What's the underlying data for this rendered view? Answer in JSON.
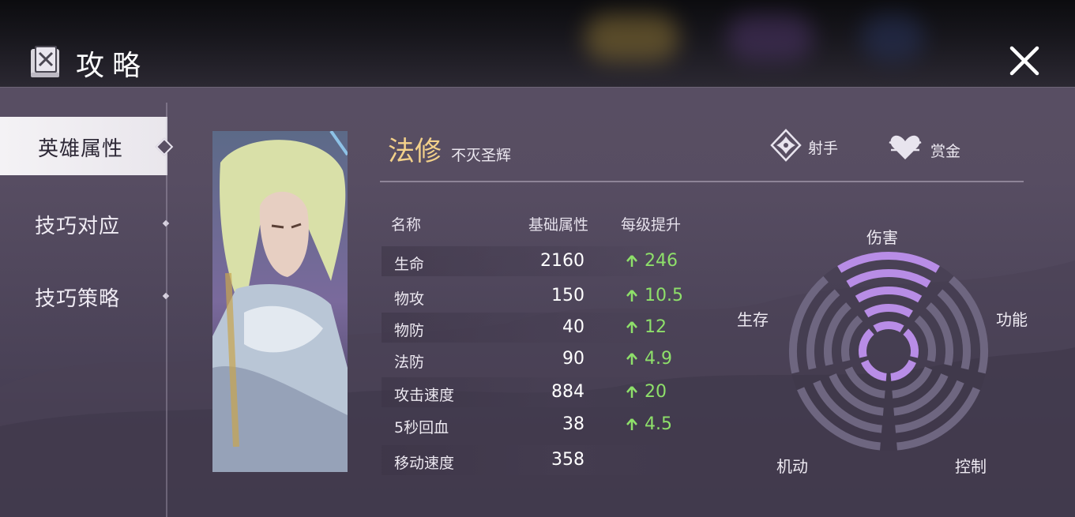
{
  "header": {
    "title": "攻略",
    "icon": "strategy-book-icon",
    "close_icon": "close-icon"
  },
  "sidebar": {
    "items": [
      {
        "label": "英雄属性",
        "active": true
      },
      {
        "label": "技巧对应",
        "active": false
      },
      {
        "label": "技巧策略",
        "active": false
      }
    ]
  },
  "hero": {
    "name": "法修",
    "title": "不灭圣辉",
    "roles": [
      {
        "label": "射手",
        "icon": "marksman-role-icon"
      },
      {
        "label": "赏金",
        "icon": "bounty-heart-icon"
      }
    ]
  },
  "stats": {
    "headers": {
      "name": "名称",
      "base": "基础属性",
      "growth": "每级提升"
    },
    "rows": [
      {
        "name": "生命",
        "base": "2160",
        "growth": "246"
      },
      {
        "name": "物攻",
        "base": "150",
        "growth": "10.5"
      },
      {
        "name": "物防",
        "base": "40",
        "growth": "12"
      },
      {
        "name": "法防",
        "base": "90",
        "growth": "4.9"
      },
      {
        "name": "攻击速度",
        "base": "884",
        "growth": "20"
      },
      {
        "name": "5秒回血",
        "base": "38",
        "growth": "4.5"
      },
      {
        "name": "移动速度",
        "base": "358",
        "growth": ""
      }
    ]
  },
  "radar": {
    "labels": {
      "damage": "伤害",
      "utility": "功能",
      "control": "控制",
      "mobility": "机动",
      "survival": "生存"
    },
    "levels_filled": {
      "damage": 5,
      "utility": 1,
      "control": 1,
      "mobility": 1,
      "survival": 1
    },
    "max_level": 5,
    "fill_color": "#b88de6",
    "empty_color": "#6e6680"
  }
}
